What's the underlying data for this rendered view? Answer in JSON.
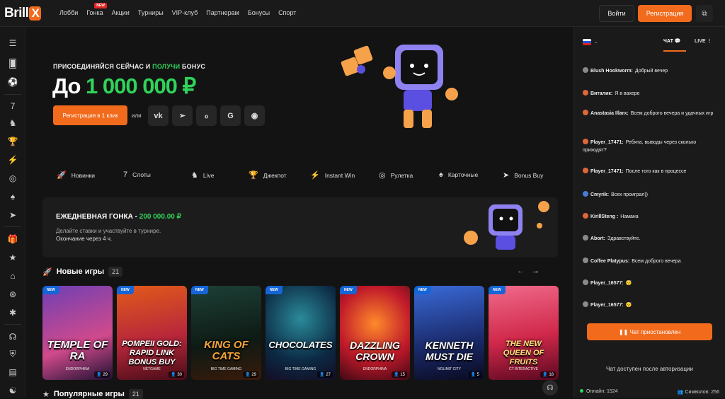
{
  "logo": {
    "text": "Brill",
    "mark": "X"
  },
  "nav": {
    "items": [
      "Лобби",
      "Гонка",
      "Акции",
      "Турниры",
      "VIP-клуб",
      "Партнерам",
      "Бонусы",
      "Спорт"
    ],
    "badge": "NEW"
  },
  "auth": {
    "login": "Войти",
    "register": "Регистрация"
  },
  "hero": {
    "sub_a": "ПРИСОЕДИНЯЙСЯ СЕЙЧАС И ",
    "sub_b": "ПОЛУЧИ",
    "sub_c": " БОНУС",
    "big_a": "До ",
    "big_b": "1 000 000 ₽",
    "cta": "Регистрация в 1 клик",
    "or": "или",
    "socials": [
      "vk-icon",
      "telegram-icon",
      "odnoklassniki-icon",
      "google-icon",
      "steam-icon"
    ]
  },
  "categories": [
    "Новинки",
    "Слоты",
    "Live",
    "Джекпот",
    "Instant Win",
    "Рулетка",
    "Карточные",
    "Bonus Buy"
  ],
  "race": {
    "title": "ЕЖЕДНЕВНАЯ ГОНКА - ",
    "amount": "200 000.00 ₽",
    "desc": "Делайте ставки и участвуйте в турнире.",
    "ends": "Окончание через 4 ч."
  },
  "new_games": {
    "title": "Новые игры",
    "count": "21"
  },
  "popular": {
    "title": "Популярные игры",
    "count": "21"
  },
  "games": [
    {
      "title": "Temple of Ra",
      "provider": "ENDORPHINA",
      "players": "29",
      "badge": "NEW"
    },
    {
      "title": "Pompeii Gold: Rapid Link Bonus Buy",
      "provider": "NETGAME",
      "players": "30",
      "badge": "NEW"
    },
    {
      "title": "King of Cats",
      "provider": "BIG TIME GAMING",
      "players": "29",
      "badge": "NEW"
    },
    {
      "title": "Chocolates",
      "provider": "BIG TIME GAMING",
      "players": "27",
      "badge": "NEW"
    },
    {
      "title": "Dazzling Crown",
      "provider": "ENDORPHINA",
      "players": "15",
      "badge": "NEW"
    },
    {
      "title": "Kenneth Must Die",
      "provider": "NOLIMIT CITY",
      "players": "5",
      "badge": "NEW"
    },
    {
      "title": "The New Queen of Fruits",
      "provider": "CT INTERACTIVE",
      "players": "18",
      "badge": "NEW"
    }
  ],
  "chat": {
    "tab_chat": "ЧАТ",
    "tab_live": "LIVE",
    "messages": [
      {
        "user": "Blush Hookworm:",
        "text": "Добрый вечер",
        "color": "#8a8a8a"
      },
      {
        "user": "Виталик:",
        "text": "Я в вахере",
        "color": "#e0673a"
      },
      {
        "user": "Anastasia Illarx:",
        "text": "Всем доброго вечера и удачных игр",
        "color": "#e0673a"
      },
      {
        "user": "Player_17471:",
        "text": "Ребята, выводы через сколько приходят?",
        "color": "#e0673a"
      },
      {
        "user": "Player_17471:",
        "text": "После того как в процессе",
        "color": "#e0673a"
      },
      {
        "user": "Cmyrik:",
        "text": "Всех проиграл))",
        "color": "#4a7bd8"
      },
      {
        "user": "KirillSteng :",
        "text": "Намана",
        "color": "#e0673a"
      },
      {
        "user": "Abort:",
        "text": "Здравствуйте.",
        "color": "#8a8a8a"
      },
      {
        "user": "Coffee Platypus:",
        "text": "Всем доброго вечера",
        "color": "#8a8a8a"
      },
      {
        "user": "Player_16577:",
        "text": "😴",
        "color": "#8a8a8a"
      },
      {
        "user": "Player_16577:",
        "text": "😴",
        "color": "#8a8a8a"
      }
    ],
    "paused": "❚❚ Чат приостановлен",
    "auth_note": "Чат доступен после авторизации",
    "online": "Онлайн: 1524",
    "chars": "Символов: 256"
  }
}
